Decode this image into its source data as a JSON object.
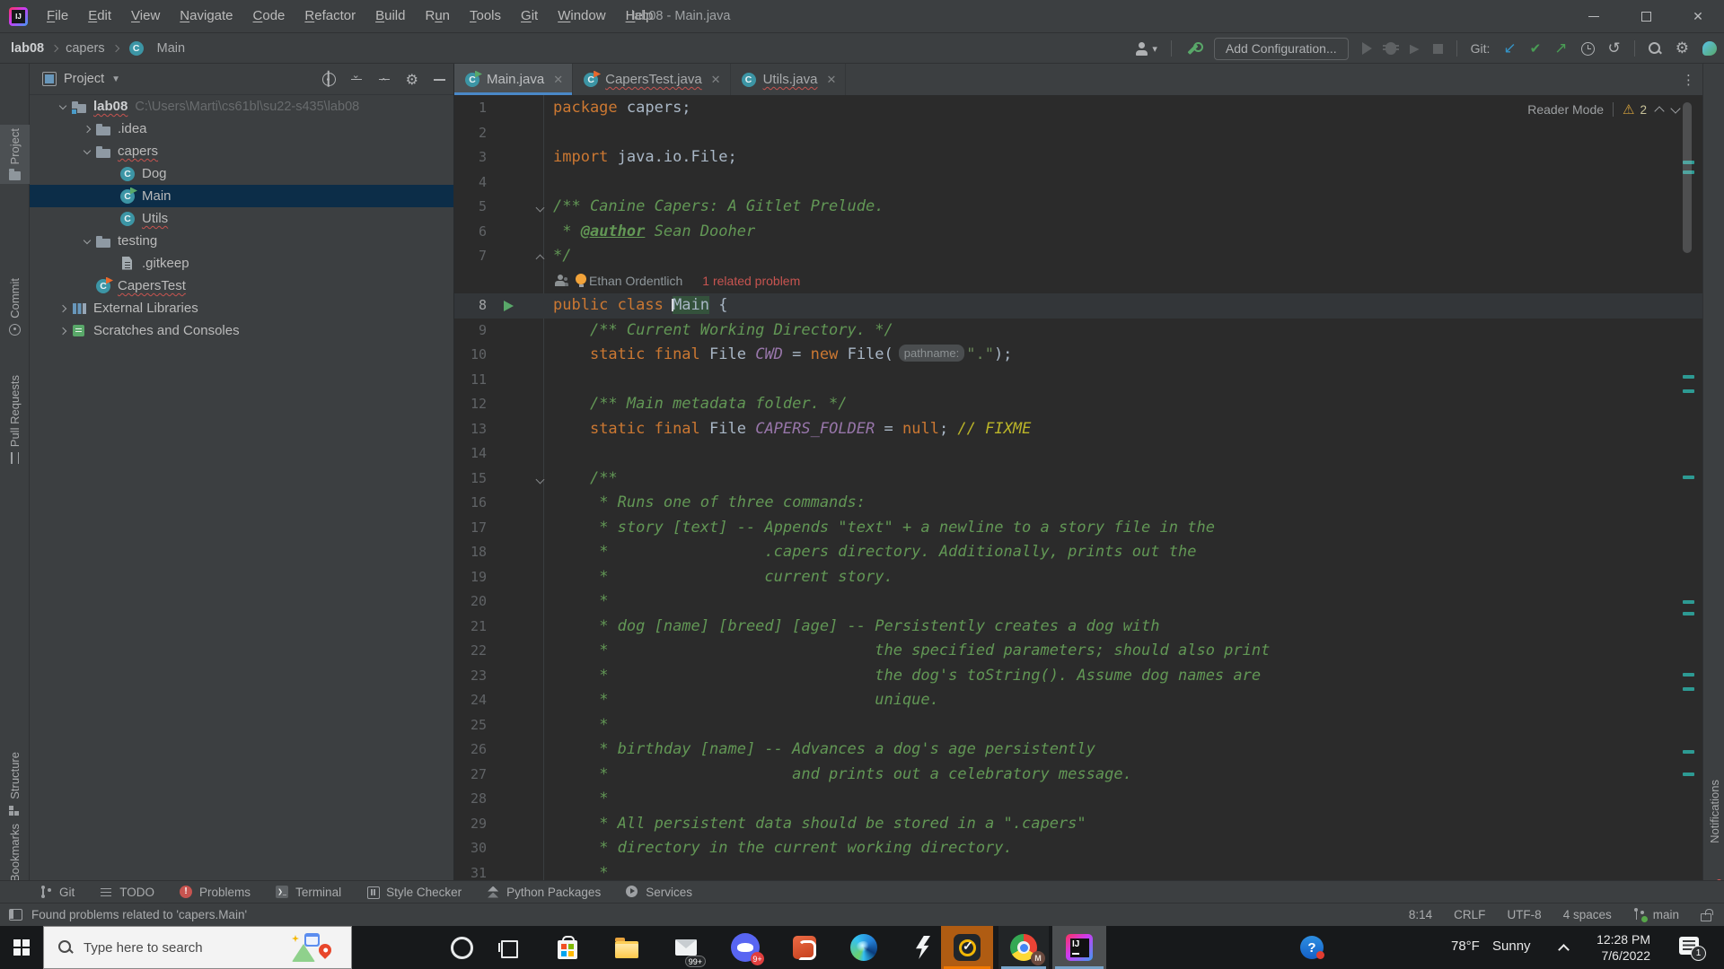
{
  "titlebar": {
    "title": "lab08 - Main.java",
    "menus": [
      [
        "File",
        0
      ],
      [
        "Edit",
        0
      ],
      [
        "View",
        0
      ],
      [
        "Navigate",
        0
      ],
      [
        "Code",
        0
      ],
      [
        "Refactor",
        0
      ],
      [
        "Build",
        0
      ],
      [
        "Run",
        1
      ],
      [
        "Tools",
        0
      ],
      [
        "Git",
        0
      ],
      [
        "Window",
        0
      ],
      [
        "Help",
        0
      ]
    ]
  },
  "toolbar": {
    "breadcrumbs": [
      "lab08",
      "capers",
      "Main"
    ],
    "add_configuration": "Add Configuration...",
    "git_label": "Git:"
  },
  "left_stripe": {
    "top": [
      {
        "label": "Project",
        "icon": "folder",
        "active": true
      },
      {
        "label": "Commit",
        "icon": "commit",
        "active": false
      },
      {
        "label": "Pull Requests",
        "icon": "pr",
        "active": false
      }
    ],
    "bottom": [
      {
        "label": "Structure",
        "icon": "structure",
        "active": false
      },
      {
        "label": "Bookmarks",
        "icon": "bookmark",
        "active": false
      }
    ]
  },
  "right_stripe": {
    "label": "Notifications"
  },
  "project_panel": {
    "header": "Project",
    "tree": [
      {
        "label": "lab08",
        "path": "C:\\Users\\Marti\\cs61bl\\su22-s435\\lab08",
        "icon": "folder-project",
        "level": 0,
        "chevron": "down",
        "bold": true,
        "error": true
      },
      {
        "label": ".idea",
        "icon": "folder",
        "level": 1,
        "chevron": "right"
      },
      {
        "label": "capers",
        "icon": "folder",
        "level": 1,
        "chevron": "down",
        "error": true
      },
      {
        "label": "Dog",
        "icon": "class",
        "level": 2
      },
      {
        "label": "Main",
        "icon": "class-run",
        "level": 2,
        "selected": true
      },
      {
        "label": "Utils",
        "icon": "class",
        "level": 2,
        "error": true
      },
      {
        "label": "testing",
        "icon": "folder",
        "level": 1,
        "chevron": "down"
      },
      {
        "label": ".gitkeep",
        "icon": "file",
        "level": 2
      },
      {
        "label": "CapersTest",
        "icon": "class-test",
        "level": 1,
        "error": true
      },
      {
        "label": "External Libraries",
        "icon": "libs",
        "level": 0,
        "chevron": "right"
      },
      {
        "label": "Scratches and Consoles",
        "icon": "scratch",
        "level": 0,
        "chevron": "right"
      }
    ]
  },
  "editor": {
    "tabs": [
      {
        "label": "Main.java",
        "icon": "class-run",
        "active": true,
        "error": false
      },
      {
        "label": "CapersTest.java",
        "icon": "class-test",
        "active": false,
        "error": true
      },
      {
        "label": "Utils.java",
        "icon": "class",
        "active": false,
        "error": true
      }
    ],
    "reader_mode": "Reader Mode",
    "warning_count": "2",
    "inlay_author": "Ethan Ordentlich",
    "inlay_problem": "1 related problem",
    "lines": [
      {
        "n": 1,
        "s": [
          [
            "k",
            "package "
          ],
          [
            "p",
            "capers;"
          ]
        ]
      },
      {
        "n": 2,
        "s": []
      },
      {
        "n": 3,
        "s": [
          [
            "k",
            "import "
          ],
          [
            "p",
            "java.io.File;"
          ]
        ]
      },
      {
        "n": 4,
        "s": []
      },
      {
        "n": 5,
        "fold": "down",
        "s": [
          [
            "d",
            "/** Canine Capers: A Gitlet Prelude."
          ]
        ]
      },
      {
        "n": 6,
        "s": [
          [
            "d",
            " * "
          ],
          [
            "dt",
            "@author"
          ],
          [
            "d",
            " Sean Dooher"
          ]
        ]
      },
      {
        "n": 7,
        "fold": "up",
        "s": [
          [
            "d",
            "*/"
          ]
        ]
      },
      {
        "inlay": true
      },
      {
        "n": 8,
        "run": true,
        "cur": true,
        "s": [
          [
            "k",
            "public class "
          ],
          [
            "hl",
            "Main"
          ],
          [
            "p",
            " {"
          ]
        ]
      },
      {
        "n": 9,
        "s": [
          [
            "p",
            "    "
          ],
          [
            "d",
            "/** Current Working Directory. */"
          ]
        ]
      },
      {
        "n": 10,
        "s": [
          [
            "p",
            "    "
          ],
          [
            "k",
            "static final "
          ],
          [
            "p",
            "File "
          ],
          [
            "f",
            "CWD"
          ],
          [
            "p",
            " = "
          ],
          [
            "k",
            "new"
          ],
          [
            "p",
            " File("
          ],
          [
            "h",
            "pathname:"
          ],
          [
            "st",
            "\".\""
          ],
          [
            "p",
            ");"
          ]
        ]
      },
      {
        "n": 11,
        "s": []
      },
      {
        "n": 12,
        "s": [
          [
            "p",
            "    "
          ],
          [
            "d",
            "/** Main metadata folder. */"
          ]
        ]
      },
      {
        "n": 13,
        "s": [
          [
            "p",
            "    "
          ],
          [
            "k",
            "static final "
          ],
          [
            "p",
            "File "
          ],
          [
            "f",
            "CAPERS_FOLDER"
          ],
          [
            "p",
            " = "
          ],
          [
            "k",
            "null"
          ],
          [
            "p",
            "; "
          ],
          [
            "td",
            "// FIXME"
          ]
        ]
      },
      {
        "n": 14,
        "s": []
      },
      {
        "n": 15,
        "fold": "down",
        "s": [
          [
            "p",
            "    "
          ],
          [
            "d",
            "/**"
          ]
        ]
      },
      {
        "n": 16,
        "s": [
          [
            "p",
            "     "
          ],
          [
            "d",
            "* Runs one of three commands:"
          ]
        ]
      },
      {
        "n": 17,
        "s": [
          [
            "p",
            "     "
          ],
          [
            "d",
            "* story [text] -- Appends \"text\" + a newline to a story file in the"
          ]
        ]
      },
      {
        "n": 18,
        "s": [
          [
            "p",
            "     "
          ],
          [
            "d",
            "*                 .capers directory. Additionally, prints out the"
          ]
        ]
      },
      {
        "n": 19,
        "s": [
          [
            "p",
            "     "
          ],
          [
            "d",
            "*                 current story."
          ]
        ]
      },
      {
        "n": 20,
        "s": [
          [
            "p",
            "     "
          ],
          [
            "d",
            "*"
          ]
        ]
      },
      {
        "n": 21,
        "s": [
          [
            "p",
            "     "
          ],
          [
            "d",
            "* dog [name] [breed] [age] -- Persistently creates a dog with"
          ]
        ]
      },
      {
        "n": 22,
        "s": [
          [
            "p",
            "     "
          ],
          [
            "d",
            "*                             the specified parameters; should also print"
          ]
        ]
      },
      {
        "n": 23,
        "s": [
          [
            "p",
            "     "
          ],
          [
            "d",
            "*                             the dog's toString(). Assume dog names are"
          ]
        ]
      },
      {
        "n": 24,
        "s": [
          [
            "p",
            "     "
          ],
          [
            "d",
            "*                             unique."
          ]
        ]
      },
      {
        "n": 25,
        "s": [
          [
            "p",
            "     "
          ],
          [
            "d",
            "*"
          ]
        ]
      },
      {
        "n": 26,
        "s": [
          [
            "p",
            "     "
          ],
          [
            "d",
            "* birthday [name] -- Advances a dog's age persistently"
          ]
        ]
      },
      {
        "n": 27,
        "s": [
          [
            "p",
            "     "
          ],
          [
            "d",
            "*                    and prints out a celebratory message."
          ]
        ]
      },
      {
        "n": 28,
        "s": [
          [
            "p",
            "     "
          ],
          [
            "d",
            "*"
          ]
        ]
      },
      {
        "n": 29,
        "s": [
          [
            "p",
            "     "
          ],
          [
            "d",
            "* All persistent data should be stored in a \".capers\""
          ]
        ]
      },
      {
        "n": 30,
        "s": [
          [
            "p",
            "     "
          ],
          [
            "d",
            "* directory in the current working directory."
          ]
        ]
      },
      {
        "n": 31,
        "s": [
          [
            "p",
            "     "
          ],
          [
            "d",
            "*"
          ]
        ]
      }
    ],
    "stripe_marks_y": [
      73,
      84,
      312,
      328,
      424,
      563,
      576,
      644,
      660,
      730,
      755
    ]
  },
  "bottom_bar": {
    "items": [
      {
        "label": "Git",
        "icon": "git"
      },
      {
        "label": "TODO",
        "icon": "todo"
      },
      {
        "label": "Problems",
        "icon": "problems"
      },
      {
        "label": "Terminal",
        "icon": "terminal"
      },
      {
        "label": "Style Checker",
        "icon": "style"
      },
      {
        "label": "Python Packages",
        "icon": "python"
      },
      {
        "label": "Services",
        "icon": "services"
      }
    ]
  },
  "status_bar": {
    "message": "Found problems related to 'capers.Main'",
    "caret_position": "8:14",
    "line_separator": "CRLF",
    "encoding": "UTF-8",
    "indent": "4 spaces",
    "branch": "main"
  },
  "taskbar": {
    "search_placeholder": "Type here to search",
    "mail_badge": "99+",
    "discord_badge": "9+",
    "chrome_profile": "M",
    "temperature": "78°F",
    "weather": "Sunny",
    "time": "12:28 PM",
    "date": "7/6/2022",
    "notification_badge": "1"
  },
  "colors": {
    "keyword": "#CC7832",
    "doc_comment": "#629755",
    "string": "#6A8759",
    "static_field": "#9876AA",
    "todo_comment": "#BBB529",
    "plain_code": "#A9B7C6",
    "error_red": "#C75450",
    "tab_underline": "#4A88C7",
    "selection_bg": "#0C2D48",
    "panel_bg": "#3C3F41",
    "editor_bg": "#2B2B2B",
    "run_green": "#59A869",
    "warning_yellow": "#D6A23C"
  }
}
